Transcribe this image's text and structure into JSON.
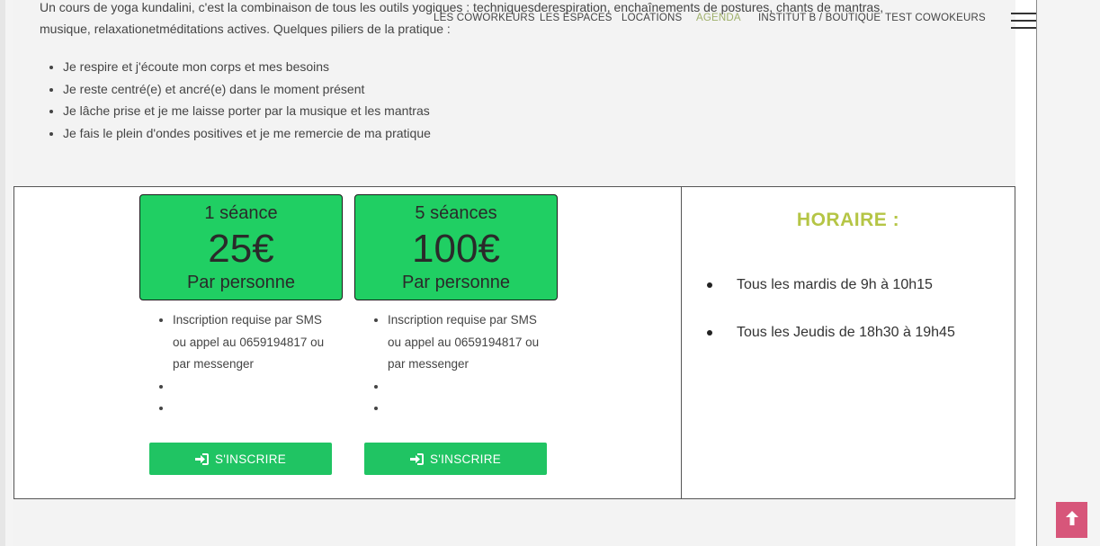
{
  "intro": {
    "text": "Un cours de yoga kundalini, c'est la combinaison de tous les outils yogiques : techniquesderespiration, enchaînements de postures, chants de mantras, musique, relaxationetméditations actives. Quelques piliers de la pratique :"
  },
  "pillars": [
    "Je respire et j'écoute mon corps et mes besoins",
    "Je reste centré(e) et ancré(e) dans le moment présent",
    "Je lâche prise et je me laisse porter par la musique et les mantras",
    "Je fais le plein d'ondes positives et je me remercie de ma pratique"
  ],
  "nav": {
    "items": [
      "LES COWORKEURS",
      "LES ESPACES",
      "LOCATIONS",
      "AGENDA",
      "INSTITUT B / BOUTIQUE",
      "TEST COWOKEURS"
    ],
    "active": "AGENDA",
    "menu_icon": "hamburger-menu-icon"
  },
  "pricing": {
    "cards": [
      {
        "sessions": "1 séance",
        "price": "25€",
        "unit": "Par personne",
        "features": [
          "Inscription requise par SMS ou appel au 0659194817 ou par messenger",
          "",
          ""
        ],
        "button": "S'INSCRIRE",
        "button_icon": "sign-in-icon"
      },
      {
        "sessions": "5 séances",
        "price": "100€",
        "unit": "Par personne",
        "features": [
          "Inscription requise par SMS ou appel au 0659194817 ou par messenger",
          "",
          ""
        ],
        "button": "S'INSCRIRE",
        "button_icon": "sign-in-icon"
      }
    ]
  },
  "horaire": {
    "title": "HORAIRE :",
    "items": [
      "Tous les mardis de 9h à 10h15",
      "Tous les Jeudis de 18h30 à 19h45"
    ]
  },
  "colors": {
    "accent_green": "#20cf63",
    "button_green": "#20c463",
    "horaire_title": "#b5c545",
    "nav_active": "#9fb06a",
    "back_to_top": "#d7567a"
  },
  "back_to_top_icon": "arrow-up-icon"
}
